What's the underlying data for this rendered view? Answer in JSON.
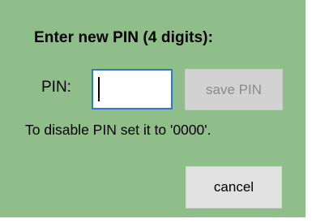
{
  "dialog": {
    "title": "Enter new PIN (4 digits):",
    "pin_label": "PIN:",
    "pin_input": {
      "value": "",
      "placeholder": ""
    },
    "save_label": "save PIN",
    "hint": "To disable PIN set it to '0000'.",
    "cancel_label": "cancel"
  },
  "colors": {
    "background": "#8fbe8b",
    "input_focus_border": "#2a78d4",
    "button_disabled": "#d2d2d2",
    "button": "#e1e1e1"
  }
}
